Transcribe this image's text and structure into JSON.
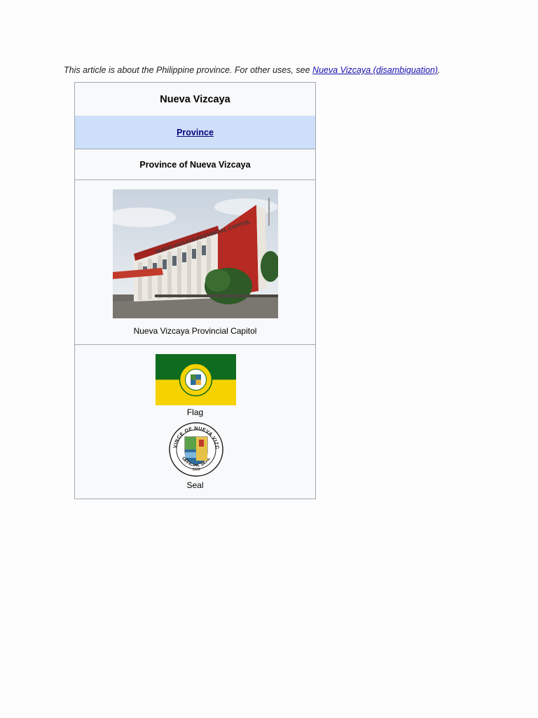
{
  "hatnote": {
    "prefix": "This article is about the Philippine province. For other uses, see ",
    "link_text": "Nueva Vizcaya (disambiguation)",
    "suffix": "."
  },
  "infobox": {
    "title": "Nueva Vizcaya",
    "type_label": "Province",
    "official_name": "Province of Nueva Vizcaya",
    "photo_caption": "Nueva Vizcaya Provincial Capitol",
    "flag_caption": "Flag",
    "seal_caption": "Seal",
    "building_sign": "NUEVA VIZCAYA PROVINCIAL CAPITOL",
    "seal_text_top": "PROVINCE OF NUEVA VIZCAYA",
    "seal_text_bottom": "OFFICIAL SEAL",
    "seal_year": "1839"
  },
  "colors": {
    "link": "#1a0dab",
    "type_band": "#cedff9",
    "flag_green": "#0e6b1f",
    "flag_yellow": "#f6d200"
  }
}
